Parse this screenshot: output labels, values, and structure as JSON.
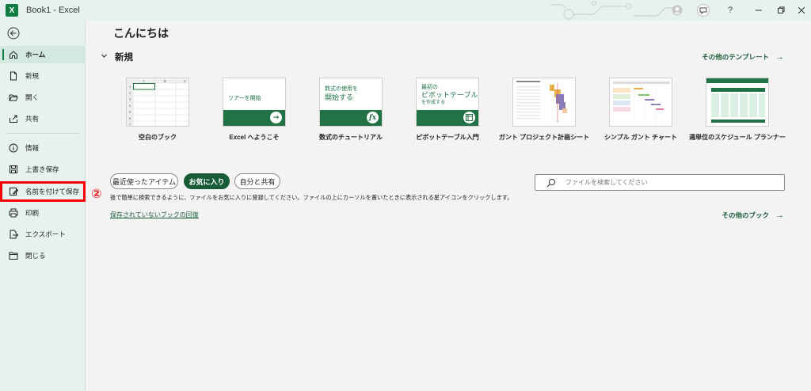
{
  "titlebar": {
    "app_title": "Book1  -  Excel",
    "logo_letter": "X",
    "help": "?"
  },
  "sidebar": {
    "items": [
      {
        "label": "ホーム",
        "icon": "home-icon",
        "active": true
      },
      {
        "label": "新規",
        "icon": "new-file-icon"
      },
      {
        "label": "開く",
        "icon": "folder-open-icon"
      },
      {
        "label": "共有",
        "icon": "share-icon"
      },
      {
        "label": "情報",
        "icon": "info-icon"
      },
      {
        "label": "上書き保存",
        "icon": "save-icon"
      },
      {
        "label": "名前を付けて保存",
        "icon": "save-as-icon",
        "highlighted": true
      },
      {
        "label": "印刷",
        "icon": "print-icon"
      },
      {
        "label": "エクスポート",
        "icon": "export-icon"
      },
      {
        "label": "閉じる",
        "icon": "close-folder-icon"
      }
    ]
  },
  "main": {
    "greeting": "こんにちは",
    "new_section": {
      "title": "新規",
      "more_link": "その他のテンプレート"
    },
    "templates": [
      {
        "label": "空白のブック"
      },
      {
        "label": "Excel へようこそ",
        "thumb_text": "ツアーを開始"
      },
      {
        "label": "数式のチュートリアル",
        "thumb_line1": "数式の使用を",
        "thumb_line2": "開始する"
      },
      {
        "label": "ピボットテーブル入門",
        "thumb_line1": "最初の",
        "thumb_line2": "ピボットテーブル",
        "thumb_line3": "を作成する"
      },
      {
        "label": "ガント プロジェクト計画シート"
      },
      {
        "label": "シンプル ガント チャート"
      },
      {
        "label": "週単位のスケジュール プランナー"
      }
    ],
    "blank_sheet": {
      "cols": [
        "A",
        "B",
        "C"
      ],
      "rows": [
        "1",
        "2",
        "3",
        "4",
        "5",
        "6",
        "7"
      ]
    },
    "filter_tabs": [
      {
        "label": "最近使ったアイテム"
      },
      {
        "label": "お気に入り",
        "active": true
      },
      {
        "label": "自分と共有"
      }
    ],
    "search": {
      "placeholder": "ファイルを検索してください",
      "value": ""
    },
    "hint": "後で簡単に検索できるように、ファイルをお気に入りに登録してください。ファイルの上にカーソルを置いたときに表示される星アイコンをクリックします。",
    "recover_link": "保存されていないブックの回復",
    "more_books": "その他のブック"
  },
  "annotation": {
    "step": "②",
    "color": "#e8262b"
  },
  "colors": {
    "accent": "#185c37",
    "excel_green": "#217346",
    "sidebar_bg": "#e6f2ef",
    "highlight_border": "#ff0000"
  }
}
